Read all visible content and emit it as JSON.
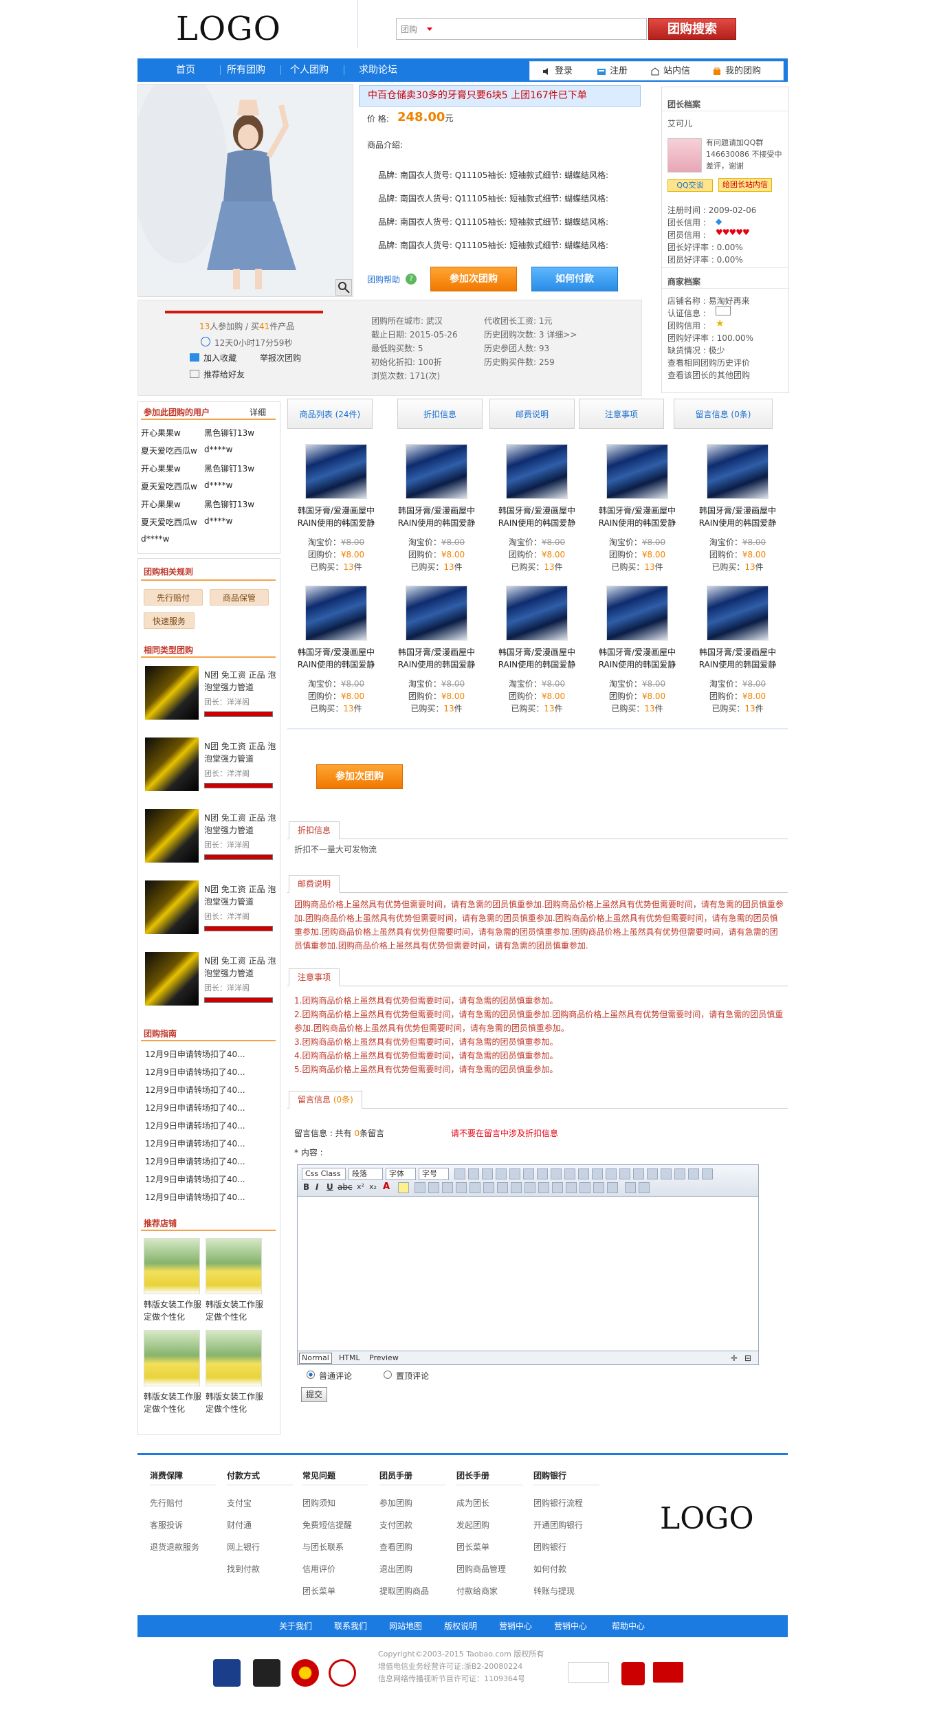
{
  "header": {
    "logo": "LOGO",
    "search_select": "团购",
    "search_button": "团购搜索"
  },
  "nav": {
    "items": [
      "首页",
      "所有团购",
      "个人团购",
      "求助论坛"
    ],
    "user": [
      "登录",
      "注册",
      "站内信",
      "我的团购"
    ]
  },
  "product": {
    "promo": "中百仓储卖30多的牙膏只要6块5 上团167件已下单",
    "price_label": "价    格:",
    "price": "248.00",
    "price_unit": "元",
    "intro_label": "商品介绍:",
    "brand_line": "品牌: 南国衣人货号: Q11105袖长: 短袖款式细节: 蝴蝶结风格:",
    "help": "团购帮助",
    "join": "参加次团购",
    "pay": "如何付款"
  },
  "stats": {
    "joined": "13",
    "joined_text": "人参加购 / 买",
    "bought": "41",
    "bought_text": "件产品",
    "countdown": "12天0小时17分59秒",
    "fav": "加入收藏",
    "report": "举报次团购",
    "recommend": "推荐给好友",
    "rows_left": [
      "团购所在城市: 武汉",
      "截止日期: 2015-05-26",
      "最低购买数: 5",
      "初始化折扣: 100折",
      "浏览次数: 171(次)"
    ],
    "rows_right": [
      "代收团长工资: 1元",
      "历史团购次数: 3 详细>>",
      "历史参团人数: 93",
      "历史购买件数: 259"
    ]
  },
  "seller": {
    "title": "团长档案",
    "name": "艾可儿",
    "note": "有问题请加QQ群146630086 不接受中差评，谢谢",
    "qq_label": "QQ交谈",
    "msg_label": "给团长站内信",
    "rows": [
      "注册时间 : 2009-02-06",
      "团长信用 :",
      "团员信用 :",
      "团长好评率 : 0.00%",
      "团员好评率 : 0.00%"
    ],
    "shop_title": "商家档案",
    "shop_rows": [
      "店铺名称 : 易淘好再来",
      "认证信息 :",
      "团购信用 :",
      "团购好评率 : 100.00%",
      "缺货情况 : 极少"
    ],
    "shop_link1": "查看相同团购历史评价",
    "shop_link2": "查看该团长的其他团购"
  },
  "members": {
    "title": "参加此团购的用户",
    "detail": "详细",
    "rows": [
      [
        "开心果果w",
        "黑色铆钉13w"
      ],
      [
        "夏天爱吃西瓜w",
        "d****w"
      ],
      [
        "开心果果w",
        "黑色铆钉13w"
      ],
      [
        "夏天爱吃西瓜w",
        "d****w"
      ],
      [
        "开心果果w",
        "黑色铆钉13w"
      ],
      [
        "夏天爱吃西瓜w",
        "d****w"
      ],
      [
        "d****w",
        ""
      ]
    ]
  },
  "rules": {
    "title": "团购相关规则",
    "pills": [
      "先行赔付",
      "商品保管",
      "快速服务"
    ]
  },
  "related": {
    "title": "相同类型团购",
    "items": [
      {
        "title": "N团 免工资 正品 泡泡堂强力管道",
        "sub": "团长：洋洋阁"
      },
      {
        "title": "N团 免工资 正品 泡泡堂强力管道",
        "sub": "团长：洋洋阁"
      },
      {
        "title": "N团 免工资 正品 泡泡堂强力管道",
        "sub": "团长：洋洋阁"
      },
      {
        "title": "N团 免工资 正品 泡泡堂强力管道",
        "sub": "团长：洋洋阁"
      },
      {
        "title": "N团 免工资 正品 泡泡堂强力管道",
        "sub": "团长：洋洋阁"
      }
    ]
  },
  "guide": {
    "title": "团购指南",
    "items": [
      "12月9日申请转场扣了40...",
      "12月9日申请转场扣了40...",
      "12月9日申请转场扣了40...",
      "12月9日申请转场扣了40...",
      "12月9日申请转场扣了40...",
      "12月9日申请转场扣了40...",
      "12月9日申请转场扣了40...",
      "12月9日申请转场扣了40...",
      "12月9日申请转场扣了40..."
    ]
  },
  "shops": {
    "title": "推荐店铺",
    "items": [
      "韩版女装工作服定做个性化",
      "韩版女装工作服定做个性化",
      "韩版女装工作服定做个性化",
      "韩版女装工作服定做个性化"
    ]
  },
  "tabs": [
    "商品列表 (24件)",
    "折扣信息",
    "邮费说明",
    "注意事项",
    "留言信息 (0条)"
  ],
  "goods": {
    "name": "韩国牙膏/爱漫画屋中RAIN使用的韩国爱静",
    "taobao_label": "淘宝价：",
    "taobao": "¥8.00",
    "group_label": "团购价：",
    "group": "¥8.00",
    "bought_label": "已购买：",
    "bought": "13",
    "bought_unit": "件"
  },
  "sections": {
    "discount_tab": "折扣信息",
    "discount_text": "折扣不一量大可发物流",
    "postage_tab": "邮费说明",
    "postage_text": "团购商品价格上虽然具有优势但需要时间，请有急需的团员慎重参加.团购商品价格上虽然具有优势但需要时间，请有急需的团员慎重参加.团购商品价格上虽然具有优势但需要时间，请有急需的团员慎重参加.团购商品价格上虽然具有优势但需要时间，请有急需的团员慎重参加.团购商品价格上虽然具有优势但需要时间，请有急需的团员慎重参加.团购商品价格上虽然具有优势但需要时间，请有急需的团员慎重参加.团购商品价格上虽然具有优势但需要时间，请有急需的团员慎重参加.",
    "notice_tab": "注意事项",
    "notice_lines": [
      "1.团购商品价格上虽然具有优势但需要时间，请有急需的团员慎重参加。",
      "2.团购商品价格上虽然具有优势但需要时间，请有急需的团员慎重参加.团购商品价格上虽然具有优势但需要时间，请有急需的团员慎重参加.团购商品价格上虽然具有优势但需要时间，请有急需的团员慎重参加。",
      "3.团购商品价格上虽然具有优势但需要时间，请有急需的团员慎重参加。",
      "4.团购商品价格上虽然具有优势但需要时间，请有急需的团员慎重参加。",
      "5.团购商品价格上虽然具有优势但需要时间，请有急需的团员慎重参加。"
    ],
    "message_tab": "留言信息",
    "message_tab_count": "(0条)"
  },
  "comment": {
    "info": "留言信息 : 共有",
    "count": "0",
    "info_end": "条留言",
    "warn": "请不要在留言中涉及折扣信息",
    "content_label": "* 内容 :",
    "selects": [
      "Css Class",
      "段落",
      "字体",
      "字号"
    ],
    "modes": [
      "Normal",
      "HTML",
      "Preview"
    ],
    "radio1": "普通评论",
    "radio2": "置顶评论",
    "submit": "提交"
  },
  "footer": {
    "cols": [
      {
        "head": "消费保障",
        "links": [
          "先行赔付",
          "客服投诉",
          "退货退款服务"
        ]
      },
      {
        "head": "付款方式",
        "links": [
          "支付宝",
          "财付通",
          "网上银行",
          "找到付款"
        ]
      },
      {
        "head": "常见问题",
        "links": [
          "团购须知",
          "免费短信提醒",
          "与团长联系",
          "信用评价",
          "团长菜单"
        ]
      },
      {
        "head": "团员手册",
        "links": [
          "参加团购",
          "支付团款",
          "查看团购",
          "退出团购",
          "提取团购商品"
        ]
      },
      {
        "head": "团长手册",
        "links": [
          "成为团长",
          "发起团购",
          "团长菜单",
          "团购商品管理",
          "付款给商家"
        ]
      },
      {
        "head": "团购银行",
        "links": [
          "团购银行流程",
          "开通团购银行",
          "团购银行",
          "如何付款",
          "转账与提现"
        ]
      }
    ],
    "logo": "LOGO",
    "nav": [
      "关于我们",
      "联系我们",
      "网站地图",
      "版权说明",
      "营销中心",
      "营销中心",
      "帮助中心"
    ],
    "copyright": [
      "Copyright©2003-2015 Taobao.com 版权所有",
      "增值电信业务经营许可证:浙B2-20080224",
      "信息网络传播视听节目许可证：1109364号"
    ]
  }
}
